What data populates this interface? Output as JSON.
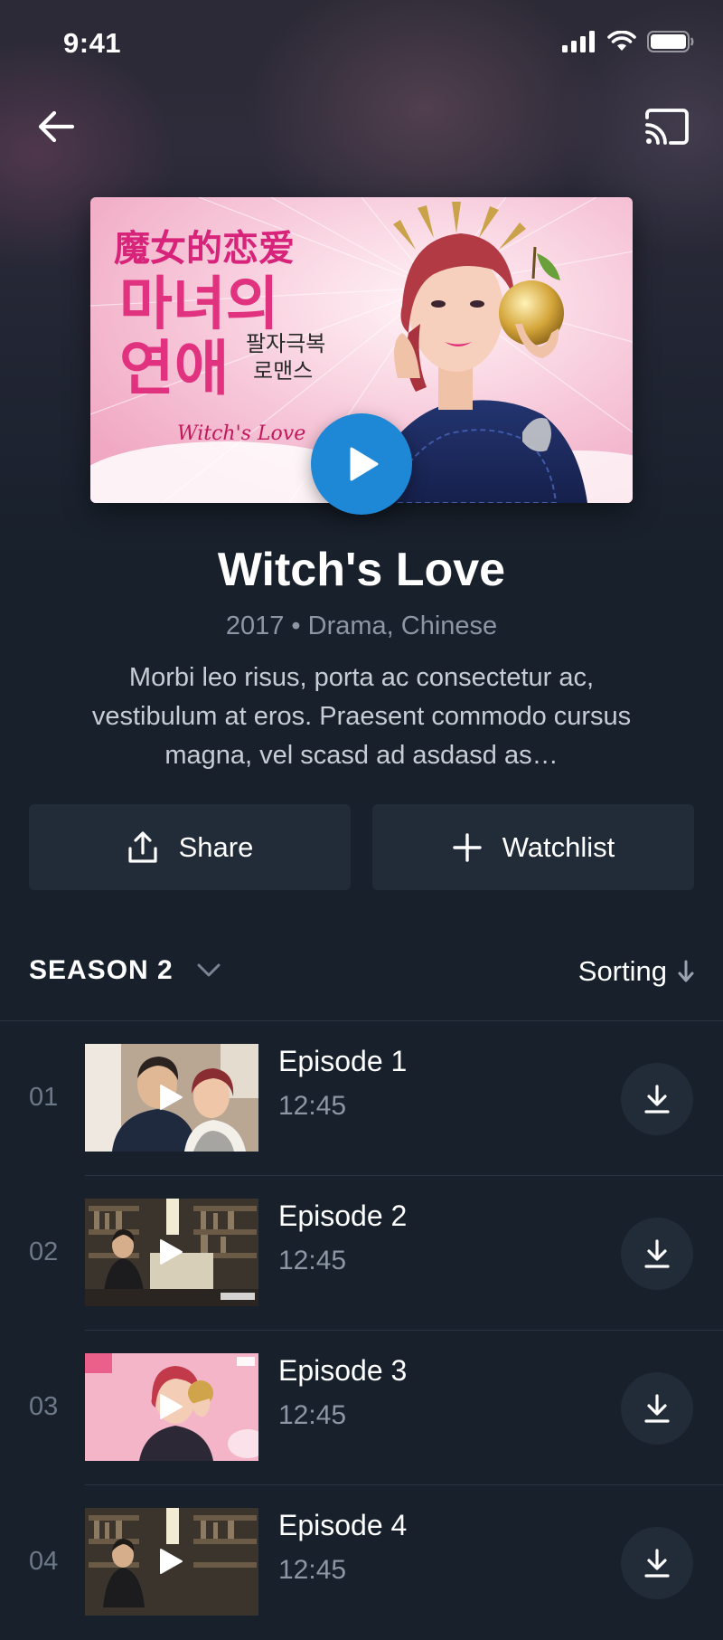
{
  "status_bar": {
    "time": "9:41"
  },
  "top_bar": {
    "back_icon": "arrow-left-icon",
    "cast_icon": "cast-icon"
  },
  "poster": {
    "chinese_title": "魔女的恋爱",
    "korean_title_line1": "마녀의",
    "korean_title_line2": "연애",
    "korean_sub_line1": "팔자극복",
    "korean_sub_line2": "로맨스",
    "english_title": "Witch's Love"
  },
  "show": {
    "title": "Witch's Love",
    "meta": "2017 • Drama, Chinese",
    "description": "Morbi leo risus, porta ac consectetur ac, vestibulum at eros. Praesent commodo cursus magna, vel scasd ad asdasd as…"
  },
  "actions": {
    "share_label": "Share",
    "watchlist_label": "Watchlist"
  },
  "season": {
    "label": "SEASON 2",
    "sorting_label": "Sorting"
  },
  "episodes": [
    {
      "number": "01",
      "title": "Episode 1",
      "duration": "12:45"
    },
    {
      "number": "02",
      "title": "Episode 2",
      "duration": "12:45"
    },
    {
      "number": "03",
      "title": "Episode 3",
      "duration": "12:45"
    },
    {
      "number": "04",
      "title": "Episode 4",
      "duration": "12:45"
    }
  ],
  "colors": {
    "background": "#17202b",
    "accent": "#1e88d6",
    "button_bg": "#222c39"
  }
}
